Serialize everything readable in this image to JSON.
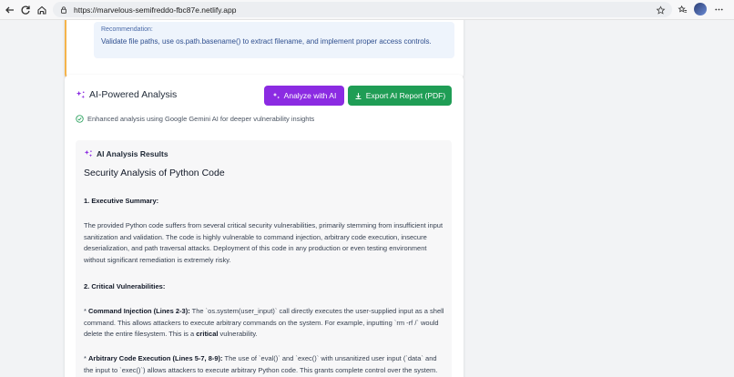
{
  "browser": {
    "url": "https://marvelous-semifreddo-fbc87e.netlify.app"
  },
  "recommendation": {
    "title": "Recommendation:",
    "text": "Validate file paths, use os.path.basename() to extract filename, and implement proper access controls."
  },
  "ai_section": {
    "title": "AI-Powered Analysis",
    "analyze_label": "Analyze with AI",
    "export_label": "Export AI Report (PDF)",
    "enhanced_text": "Enhanced analysis using Google Gemini AI for deeper vulnerability insights",
    "accent_purple": "#8b2be2",
    "accent_green": "#1f9d55"
  },
  "results": {
    "header": "AI Analysis Results",
    "title": "Security Analysis of Python Code",
    "section1": "1. Executive Summary:",
    "summary": "The provided Python code suffers from several critical security vulnerabilities, primarily stemming from insufficient input sanitization and validation.  The code is highly vulnerable to command injection, arbitrary code execution, insecure deserialization, and path traversal attacks.  Deployment of this code in any production or even testing environment without significant remediation is extremely risky.",
    "section2": "2. Critical Vulnerabilities:",
    "vuln1_label": "Command Injection (Lines 2-3):",
    "vuln1_text_a": "  The `os.system(user_input)` call directly executes the user-supplied input as a shell command. This allows attackers to execute arbitrary commands on the system.  For example, inputting `rm -rf /` would delete the entire filesystem. This is a ",
    "vuln1_strong": "critical",
    "vuln1_text_b": " vulnerability.",
    "vuln2_label": "Arbitrary Code Execution (Lines 5-7, 8-9):",
    "vuln2_text": " The use of `eval()` and `exec()` with unsanitized user input (`data` and the input to `exec()`) allows attackers to execute arbitrary Python code. This grants complete control over the system.  This is"
  }
}
